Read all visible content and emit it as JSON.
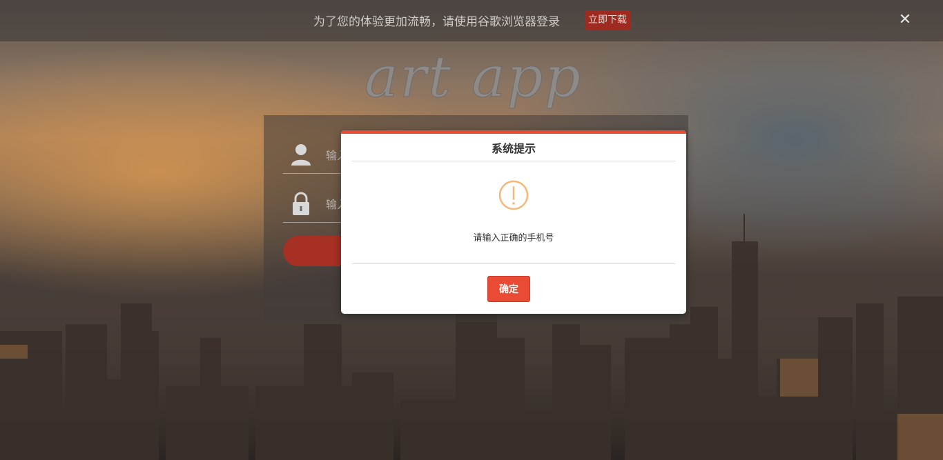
{
  "notice": {
    "text": "为了您的体验更加流畅，请使用谷歌浏览器登录",
    "download_label": "立即下载",
    "close_label": "✕"
  },
  "logo": {
    "text": "art app"
  },
  "login": {
    "username_placeholder": "输入",
    "password_placeholder": "输入"
  },
  "dialog": {
    "title": "系统提示",
    "message": "请输入正确的手机号",
    "confirm_label": "确定",
    "icon": "exclamation-circle-icon"
  },
  "colors": {
    "accent": "#e94b35",
    "notice_button": "#9e2a20",
    "warning_icon": "#f5b87a",
    "login_button": "#a63023"
  }
}
